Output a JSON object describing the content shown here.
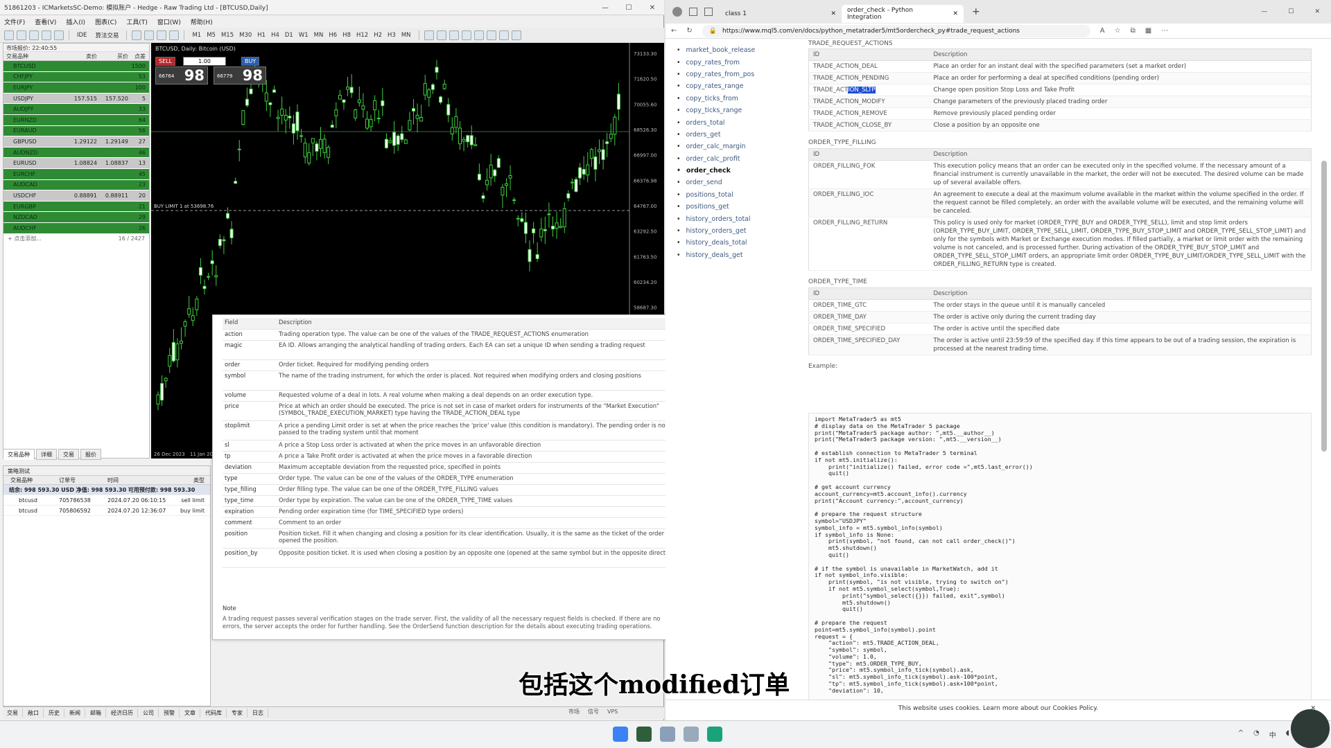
{
  "mt5": {
    "title": "51861203 - ICMarketsSC-Demo: 模拟账户 - Hedge - Raw Trading Ltd - [BTCUSD,Daily]",
    "menu": [
      "文件(F)",
      "查看(V)",
      "插入(I)",
      "图表(C)",
      "工具(T)",
      "窗口(W)",
      "帮助(H)"
    ],
    "toolbar": {
      "ide": "IDE",
      "algo": "算法交易",
      "timeframes": [
        "M1",
        "M5",
        "M15",
        "M30",
        "H1",
        "H4",
        "D1",
        "W1",
        "MN",
        "H6",
        "H8",
        "H12",
        "H2",
        "H3",
        "MN"
      ]
    },
    "market_watch": {
      "header": "市场报价: 22:40:55",
      "cols": [
        "交易品种",
        "卖价",
        "买价",
        "点差"
      ],
      "rows": [
        {
          "sym": "BTCUSD",
          "bid": "",
          "ask": "",
          "spread": "1500",
          "color": "#2e8b34"
        },
        {
          "sym": "CHFJPY",
          "bid": "",
          "ask": "",
          "spread": "53",
          "color": "#2e8b34"
        },
        {
          "sym": "EURJPY",
          "bid": "",
          "ask": "",
          "spread": "100",
          "color": "#2e8b34"
        },
        {
          "sym": "USDJPY",
          "bid": "157.515",
          "ask": "157.520",
          "spread": "5",
          "color": "#c8c8c8"
        },
        {
          "sym": "AUDJPY",
          "bid": "",
          "ask": "",
          "spread": "33",
          "color": "#2e8b34"
        },
        {
          "sym": "EURNZD",
          "bid": "",
          "ask": "",
          "spread": "64",
          "color": "#2e8b34"
        },
        {
          "sym": "EURAUD",
          "bid": "",
          "ask": "",
          "spread": "56",
          "color": "#2e8b34"
        },
        {
          "sym": "GBPUSD",
          "bid": "1.29122",
          "ask": "1.29149",
          "spread": "27",
          "color": "#c8c8c8"
        },
        {
          "sym": "AUDNZD",
          "bid": "",
          "ask": "",
          "spread": "46",
          "color": "#2e8b34"
        },
        {
          "sym": "EURUSD",
          "bid": "1.08824",
          "ask": "1.08837",
          "spread": "13",
          "color": "#c8c8c8"
        },
        {
          "sym": "EURCHF",
          "bid": "",
          "ask": "",
          "spread": "45",
          "color": "#2e8b34"
        },
        {
          "sym": "AUDCAD",
          "bid": "",
          "ask": "",
          "spread": "23",
          "color": "#2e8b34"
        },
        {
          "sym": "USDCHF",
          "bid": "0.88891",
          "ask": "0.88911",
          "spread": "20",
          "color": "#c8c8c8"
        },
        {
          "sym": "EURGBP",
          "bid": "",
          "ask": "",
          "spread": "21",
          "color": "#2e8b34"
        },
        {
          "sym": "NZDCAD",
          "bid": "",
          "ask": "",
          "spread": "29",
          "color": "#2e8b34"
        },
        {
          "sym": "AUDCHF",
          "bid": "",
          "ask": "",
          "spread": "26",
          "color": "#2e8b34"
        }
      ],
      "add_label": "+ 点击添加...",
      "count": "16 / 2427",
      "tabs": [
        "交易品种",
        "详细",
        "交易",
        "报价"
      ]
    },
    "chart": {
      "symbol_label": "BTCUSD, Daily: Bitcoin (USD)",
      "sell_label": "SELL",
      "buy_label": "BUY",
      "lot": "1.00",
      "sell_small": "66764",
      "sell_big": "98",
      "buy_small": "66779",
      "buy_big": "98",
      "buy_limit_label": "BUY LIMIT 1 at 53698.76",
      "price_ticks": [
        "73133.30",
        "71620.50",
        "70055.60",
        "68526.30",
        "66997.00",
        "66376.98",
        "64767.00",
        "63292.50",
        "61763.50",
        "60234.20",
        "58687.30",
        "57205.50",
        "55676.20",
        "54138.80",
        "52617.40",
        "51087.80"
      ],
      "date_ticks": [
        "26 Dec 2023",
        "11 Jan 2024"
      ]
    },
    "toolbox": {
      "title": "策略测试",
      "cols": [
        "交易品种",
        "订单号",
        "时间",
        "类型"
      ],
      "balance_row": "结余: 998 593.30 USD  净值: 998 593.30  可用预付款: 998 593.30",
      "rows": [
        {
          "sym": "btcusd",
          "ticket": "705786538",
          "time": "2024.07.20 06:10:15",
          "type": "sell limit"
        },
        {
          "sym": "btcusd",
          "ticket": "705806592",
          "time": "2024.07.20 12:36:07",
          "type": "buy limit"
        }
      ]
    },
    "bottom_tabs": [
      "交易",
      "敞口",
      "历史",
      "新闻",
      "邮箱",
      "经济日历",
      "公司",
      "预警",
      "文章",
      "代码库",
      "专家",
      "日志"
    ],
    "status": [
      "市场",
      "信号",
      "VPS"
    ]
  },
  "overlay": {
    "head_field": "Field",
    "head_desc": "Description",
    "rows": [
      {
        "f": "action",
        "d": "Trading operation type. The value can be one of the values of the TRADE_REQUEST_ACTIONS enumeration"
      },
      {
        "f": "magic",
        "d": "EA ID. Allows arranging the analytical handling of trading orders. Each EA can set a unique ID when sending a trading request"
      },
      {
        "f": "order",
        "d": "Order ticket. Required for modifying pending orders"
      },
      {
        "f": "symbol",
        "d": "The name of the trading instrument, for which the order is placed. Not required when modifying orders and closing positions"
      },
      {
        "f": "volume",
        "d": "Requested volume of a deal in lots. A real volume when making a deal depends on an order execution type."
      },
      {
        "f": "price",
        "d": "Price at which an order should be executed. The price is not set in case of market orders for instruments of the \"Market Execution\" (SYMBOL_TRADE_EXECUTION_MARKET) type having the TRADE_ACTION_DEAL type"
      },
      {
        "f": "stoplimit",
        "d": "A price a pending Limit order is set at when the price reaches the 'price' value (this condition is mandatory). The pending order is not passed to the trading system until that moment"
      },
      {
        "f": "sl",
        "d": "A price a Stop Loss order is activated at when the price moves in an unfavorable direction"
      },
      {
        "f": "tp",
        "d": "A price a Take Profit order is activated at when the price moves in a favorable direction"
      },
      {
        "f": "deviation",
        "d": "Maximum acceptable deviation from the requested price, specified in points"
      },
      {
        "f": "type",
        "d": "Order type. The value can be one of the values of the ORDER_TYPE enumeration"
      },
      {
        "f": "type_filling",
        "d": "Order filling type. The value can be one of the ORDER_TYPE_FILLING values"
      },
      {
        "f": "type_time",
        "d": "Order type by expiration. The value can be one of the ORDER_TYPE_TIME values"
      },
      {
        "f": "expiration",
        "d": "Pending order expiration time (for TIME_SPECIFIED type orders)"
      },
      {
        "f": "comment",
        "d": "Comment to an order"
      },
      {
        "f": "position",
        "d": "Position ticket. Fill it when changing and closing a position for its clear identification. Usually, it is the same as the ticket of the order that opened the position."
      },
      {
        "f": "position_by",
        "d": "Opposite position ticket. It is used when closing a position by an opposite one (opened at the same symbol but in the opposite direction)."
      }
    ],
    "note_title": "Note",
    "note_text": "A trading request passes several verification stages on the trade server. First, the validity of all the necessary request fields is checked. If there are no errors, the server accepts the order for further handling. See the OrderSend function description for the details about executing trading operations."
  },
  "browser": {
    "tabs": [
      {
        "label": "class 1"
      },
      {
        "label": "order_check - Python Integration"
      }
    ],
    "url": "https://www.mql5.com/en/docs/python_metatrader5/mt5ordercheck_py#trade_request_actions",
    "side_nav": [
      "market_book_release",
      "copy_rates_from",
      "copy_rates_from_pos",
      "copy_rates_range",
      "copy_ticks_from",
      "copy_ticks_range",
      "orders_total",
      "orders_get",
      "order_calc_margin",
      "order_calc_profit",
      "order_check",
      "order_send",
      "positions_total",
      "positions_get",
      "history_orders_total",
      "history_orders_get",
      "history_deals_total",
      "history_deals_get"
    ],
    "current_nav": "order_check",
    "sec1": "TRADE_REQUEST_ACTIONS",
    "th_id": "ID",
    "th_desc": "Description",
    "actions": [
      {
        "id": "TRADE_ACTION_DEAL",
        "d": "Place an order for an instant deal with the specified parameters (set a market order)"
      },
      {
        "id": "TRADE_ACTION_PENDING",
        "d": "Place an order for performing a deal at specified conditions (pending order)"
      },
      {
        "id": "TRADE_ACTION_SLTP",
        "d": "Change open position Stop Loss and Take Profit"
      },
      {
        "id": "TRADE_ACTION_MODIFY",
        "d": "Change parameters of the previously placed trading order"
      },
      {
        "id": "TRADE_ACTION_REMOVE",
        "d": "Remove previously placed pending order"
      },
      {
        "id": "TRADE_ACTION_CLOSE_BY",
        "d": "Close a position by an opposite one"
      }
    ],
    "sec2": "ORDER_TYPE_FILLING",
    "filling": [
      {
        "id": "ORDER_FILLING_FOK",
        "d": "This execution policy means that an order can be executed only in the specified volume. If the necessary amount of a financial instrument is currently unavailable in the market, the order will not be executed. The desired volume can be made up of several available offers."
      },
      {
        "id": "ORDER_FILLING_IOC",
        "d": "An agreement to execute a deal at the maximum volume available in the market within the volume specified in the order. If the request cannot be filled completely, an order with the available volume will be executed, and the remaining volume will be canceled."
      },
      {
        "id": "ORDER_FILLING_RETURN",
        "d": "This policy is used only for market (ORDER_TYPE_BUY and ORDER_TYPE_SELL), limit and stop limit orders (ORDER_TYPE_BUY_LIMIT, ORDER_TYPE_SELL_LIMIT, ORDER_TYPE_BUY_STOP_LIMIT and ORDER_TYPE_SELL_STOP_LIMIT) and only for the symbols with Market or Exchange execution modes. If filled partially, a market or limit order with the remaining volume is not canceled, and is processed further. During activation of the ORDER_TYPE_BUY_STOP_LIMIT and ORDER_TYPE_SELL_STOP_LIMIT orders, an appropriate limit order ORDER_TYPE_BUY_LIMIT/ORDER_TYPE_SELL_LIMIT with the ORDER_FILLING_RETURN type is created."
      }
    ],
    "sec3": "ORDER_TYPE_TIME",
    "time": [
      {
        "id": "ORDER_TIME_GTC",
        "d": "The order stays in the queue until it is manually canceled"
      },
      {
        "id": "ORDER_TIME_DAY",
        "d": "The order is active only during the current trading day"
      },
      {
        "id": "ORDER_TIME_SPECIFIED",
        "d": "The order is active until the specified date"
      },
      {
        "id": "ORDER_TIME_SPECIFIED_DAY",
        "d": "The order is active until 23:59:59 of the specified day. If this time appears to be out of a trading session, the expiration is processed at the nearest trading time."
      }
    ],
    "example_label": "Example:",
    "code": "import MetaTrader5 as mt5\n# display data on the MetaTrader 5 package\nprint(\"MetaTrader5 package author: \",mt5.__author__)\nprint(\"MetaTrader5 package version: \",mt5.__version__)\n\n# establish connection to MetaTrader 5 terminal\nif not mt5.initialize():\n    print(\"initialize() failed, error code =\",mt5.last_error())\n    quit()\n\n# get account currency\naccount_currency=mt5.account_info().currency\nprint(\"Account currency:\",account_currency)\n\n# prepare the request structure\nsymbol=\"USDJPY\"\nsymbol_info = mt5.symbol_info(symbol)\nif symbol_info is None:\n    print(symbol, \"not found, can not call order_check()\")\n    mt5.shutdown()\n    quit()\n\n# if the symbol is unavailable in MarketWatch, add it\nif not symbol_info.visible:\n    print(symbol, \"is not visible, trying to switch on\")\n    if not mt5.symbol_select(symbol,True):\n        print(\"symbol_select({}}) failed, exit\",symbol)\n        mt5.shutdown()\n        quit()\n\n# prepare the request\npoint=mt5.symbol_info(symbol).point\nrequest = {\n    \"action\": mt5.TRADE_ACTION_DEAL,\n    \"symbol\": symbol,\n    \"volume\": 1.0,\n    \"type\": mt5.ORDER_TYPE_BUY,\n    \"price\": mt5.symbol_info_tick(symbol).ask,\n    \"sl\": mt5.symbol_info_tick(symbol).ask-100*point,\n    \"tp\": mt5.symbol_info_tick(symbol).ask+100*point,\n    \"deviation\": 10,",
    "cookie": "This website uses cookies. Learn more about our Cookies Policy."
  },
  "subtitle": "包括这个modified订单"
}
